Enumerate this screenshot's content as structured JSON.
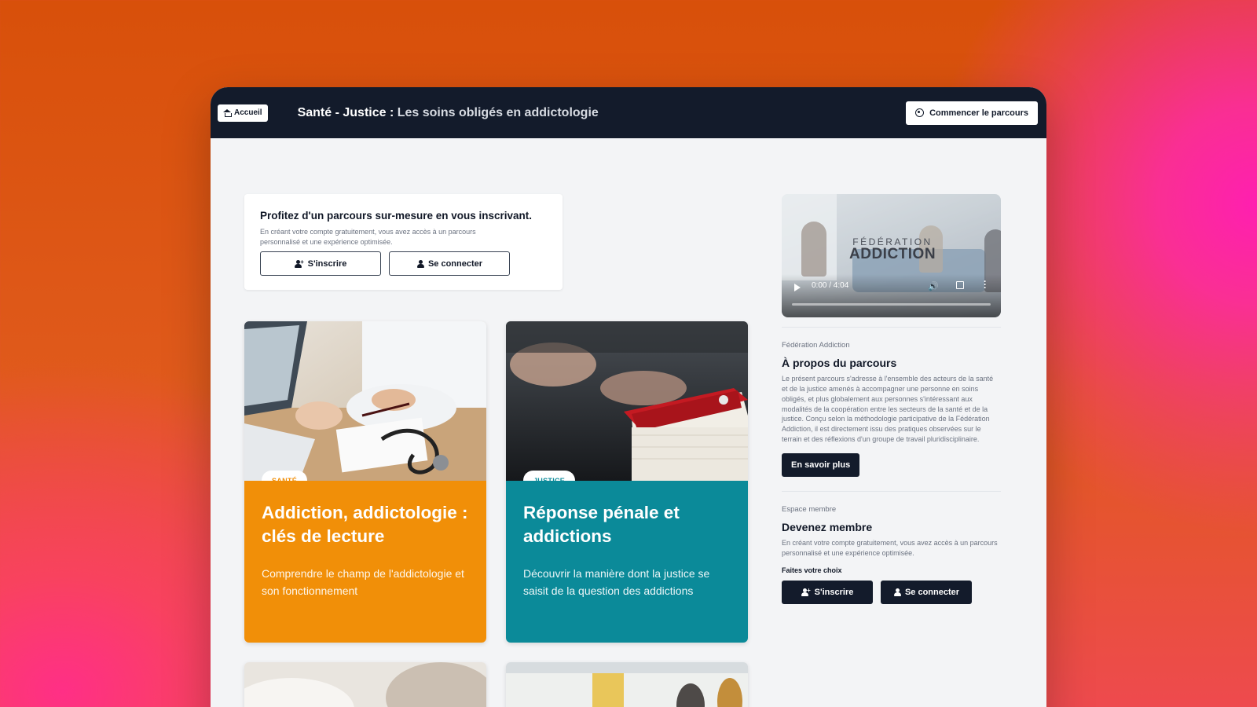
{
  "header": {
    "home_label": "Accueil",
    "title_bold": "Santé - Justice : ",
    "title_sub": "Les soins obligés en addictologie",
    "start_label": "Commencer le parcours"
  },
  "signup": {
    "heading": "Profitez d'un parcours sur-mesure en vous inscrivant.",
    "text": "En créant votre compte gratuitement, vous avez accès à un parcours personnalisé et une expérience optimisée.",
    "register_label": "S'inscrire",
    "login_label": "Se connecter"
  },
  "cards": [
    {
      "badge": "SANTÉ",
      "title": "Addiction, addictologie : clés de lecture",
      "description": "Comprendre le champ de l'addictologie et son fonctionnement",
      "color": "#f18f08"
    },
    {
      "badge": "JUSTICE",
      "title": "Réponse pénale et addictions",
      "description": "Découvrir la manière dont la justice se saisit de la question des addictions",
      "color": "#0b8a99"
    }
  ],
  "video": {
    "logo_line1": "FÉDÉRATION",
    "logo_line2": "ADDICTION",
    "time": "0:00 / 4:04"
  },
  "about": {
    "eyebrow": "Fédération Addiction",
    "heading": "À propos du parcours",
    "text": "Le présent parcours s'adresse à l'ensemble des acteurs de la santé et de la justice amenés à accompagner une personne en soins obligés, et plus globalement aux personnes s'intéressant aux modalités de la coopération entre les secteurs de la santé et de la justice. Conçu selon la méthodologie participative de la Fédération Addiction, il est directement issu des pratiques observées sur le terrain et des réflexions d'un groupe de travail pluridisciplinaire.",
    "button": "En savoir plus"
  },
  "member": {
    "eyebrow": "Espace membre",
    "heading": "Devenez membre",
    "text": "En créant votre compte gratuitement, vous avez accès à un parcours personnalisé et une expérience optimisée.",
    "choice": "Faites votre choix",
    "register_label": "S'inscrire",
    "login_label": "Se connecter"
  },
  "colors": {
    "navy": "#131b2b",
    "sante": "#f18f08",
    "justice": "#0b8a99"
  }
}
